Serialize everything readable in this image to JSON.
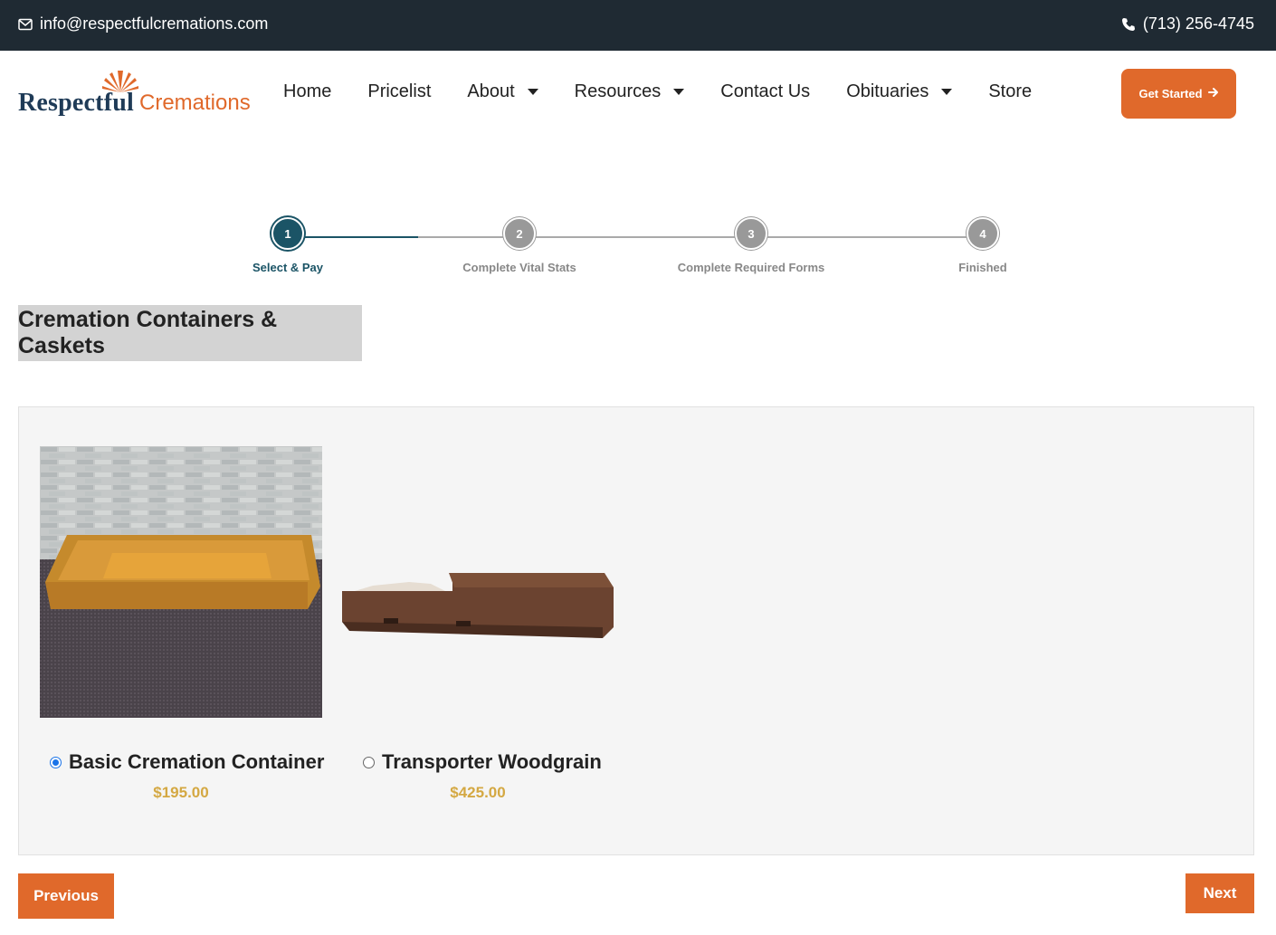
{
  "topbar": {
    "email": "info@respectfulcremations.com",
    "phone": "(713) 256-4745"
  },
  "logo": {
    "word1": "Respectful",
    "word2": "Cremations"
  },
  "nav": {
    "items": [
      {
        "label": "Home",
        "dropdown": false
      },
      {
        "label": "Pricelist",
        "dropdown": false
      },
      {
        "label": "About",
        "dropdown": true
      },
      {
        "label": "Resources",
        "dropdown": true
      },
      {
        "label": "Contact Us",
        "dropdown": false
      },
      {
        "label": "Obituaries",
        "dropdown": true
      },
      {
        "label": "Store",
        "dropdown": false
      }
    ],
    "cta_label": "Get Started"
  },
  "stepper": {
    "current": 1,
    "steps": [
      {
        "number": "1",
        "label": "Select & Pay"
      },
      {
        "number": "2",
        "label": "Complete Vital Stats"
      },
      {
        "number": "3",
        "label": "Complete Required Forms"
      },
      {
        "number": "4",
        "label": "Finished"
      }
    ]
  },
  "section": {
    "title": "Cremation Containers & Caskets"
  },
  "products": [
    {
      "name": "Basic Cremation Container",
      "price": "$195.00",
      "selected": true
    },
    {
      "name": "Transporter Woodgrain",
      "price": "$425.00",
      "selected": false
    }
  ],
  "footer": {
    "previous_label": "Previous",
    "next_label": "Next"
  },
  "colors": {
    "accent": "#e0692b",
    "topbar": "#1f2a33",
    "step_active": "#1b5466",
    "price": "#d4a842"
  }
}
